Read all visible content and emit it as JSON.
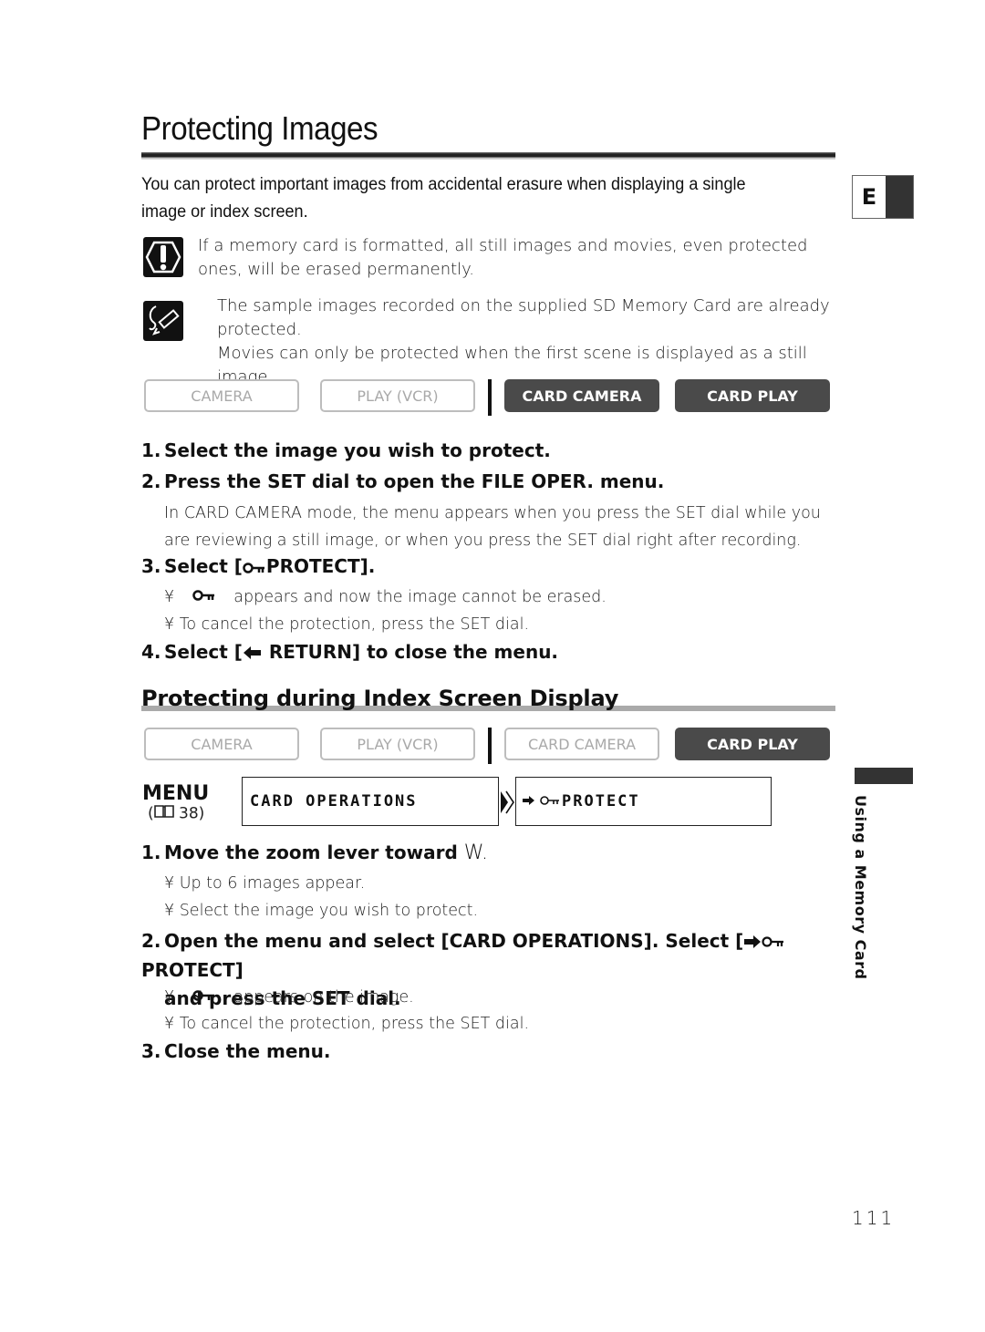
{
  "page": {
    "title": "Protecting Images",
    "intro": "You can protect important images from accidental erasure when displaying a single image or index screen.",
    "language_tab": "E",
    "warning": "If a memory card is formatted, all still images and movies, even protected ones, will be erased permanently.",
    "notes": [
      "The sample images recorded on the supplied SD Memory Card are already protected.",
      "Movies can only be protected when the first scene is displayed as a still image."
    ],
    "page_number": "111",
    "side_section": "Using a Memory Card"
  },
  "modes_single": [
    {
      "label": "CAMERA",
      "active": false
    },
    {
      "label": "PLAY (VCR)",
      "active": false
    },
    {
      "label": "CARD CAMERA",
      "active": true
    },
    {
      "label": "CARD PLAY",
      "active": true
    }
  ],
  "single_steps": {
    "s1": {
      "num": "1.",
      "text": "Select the image you wish to protect."
    },
    "s2": {
      "num": "2.",
      "text": "Press the SET dial to open the FILE OPER. menu."
    },
    "s2_body": "In CARD CAMERA mode, the menu appears when you press the SET dial while you are reviewing a still image, or when you press the SET dial right after recording.",
    "s3": {
      "num": "3.",
      "prefix": "Select [",
      "label": "PROTECT]."
    },
    "s3_b1_bullet": "¥",
    "s3_b1": "appears and now the image cannot be erased.",
    "s3_b2": "¥ To cancel the protection, press the SET dial.",
    "s4": {
      "num": "4.",
      "prefix": "Select [",
      "label": "RETURN] to close the menu."
    }
  },
  "index_section": {
    "heading": "Protecting during Index Screen Display",
    "modes": [
      {
        "label": "CAMERA",
        "active": false
      },
      {
        "label": "PLAY (VCR)",
        "active": false
      },
      {
        "label": "CARD CAMERA",
        "active": false
      },
      {
        "label": "CARD PLAY",
        "active": true
      }
    ],
    "menu_label": "MENU",
    "menu_ref_open": "(",
    "menu_ref_page": "38)",
    "menu_path": [
      "CARD OPERATIONS",
      "PROTECT"
    ],
    "steps": {
      "s1": {
        "num": "1.",
        "text": "Move the zoom lever toward ",
        "w": "W."
      },
      "s1_b1": "¥ Up to 6 images appear.",
      "s1_b2": "¥ Select the image you wish to protect.",
      "s2": {
        "num": "2.",
        "line1_prefix": "Open the menu and select [CARD OPERATIONS]. Select [",
        "line1_label": "PROTECT]",
        "line2": "and press the SET dial."
      },
      "s2_b1_bullet": "¥",
      "s2_b1": "appears on the image.",
      "s2_b2": "¥ To cancel the protection, press the SET dial.",
      "s3": {
        "num": "3.",
        "text": "Close the menu."
      }
    }
  }
}
